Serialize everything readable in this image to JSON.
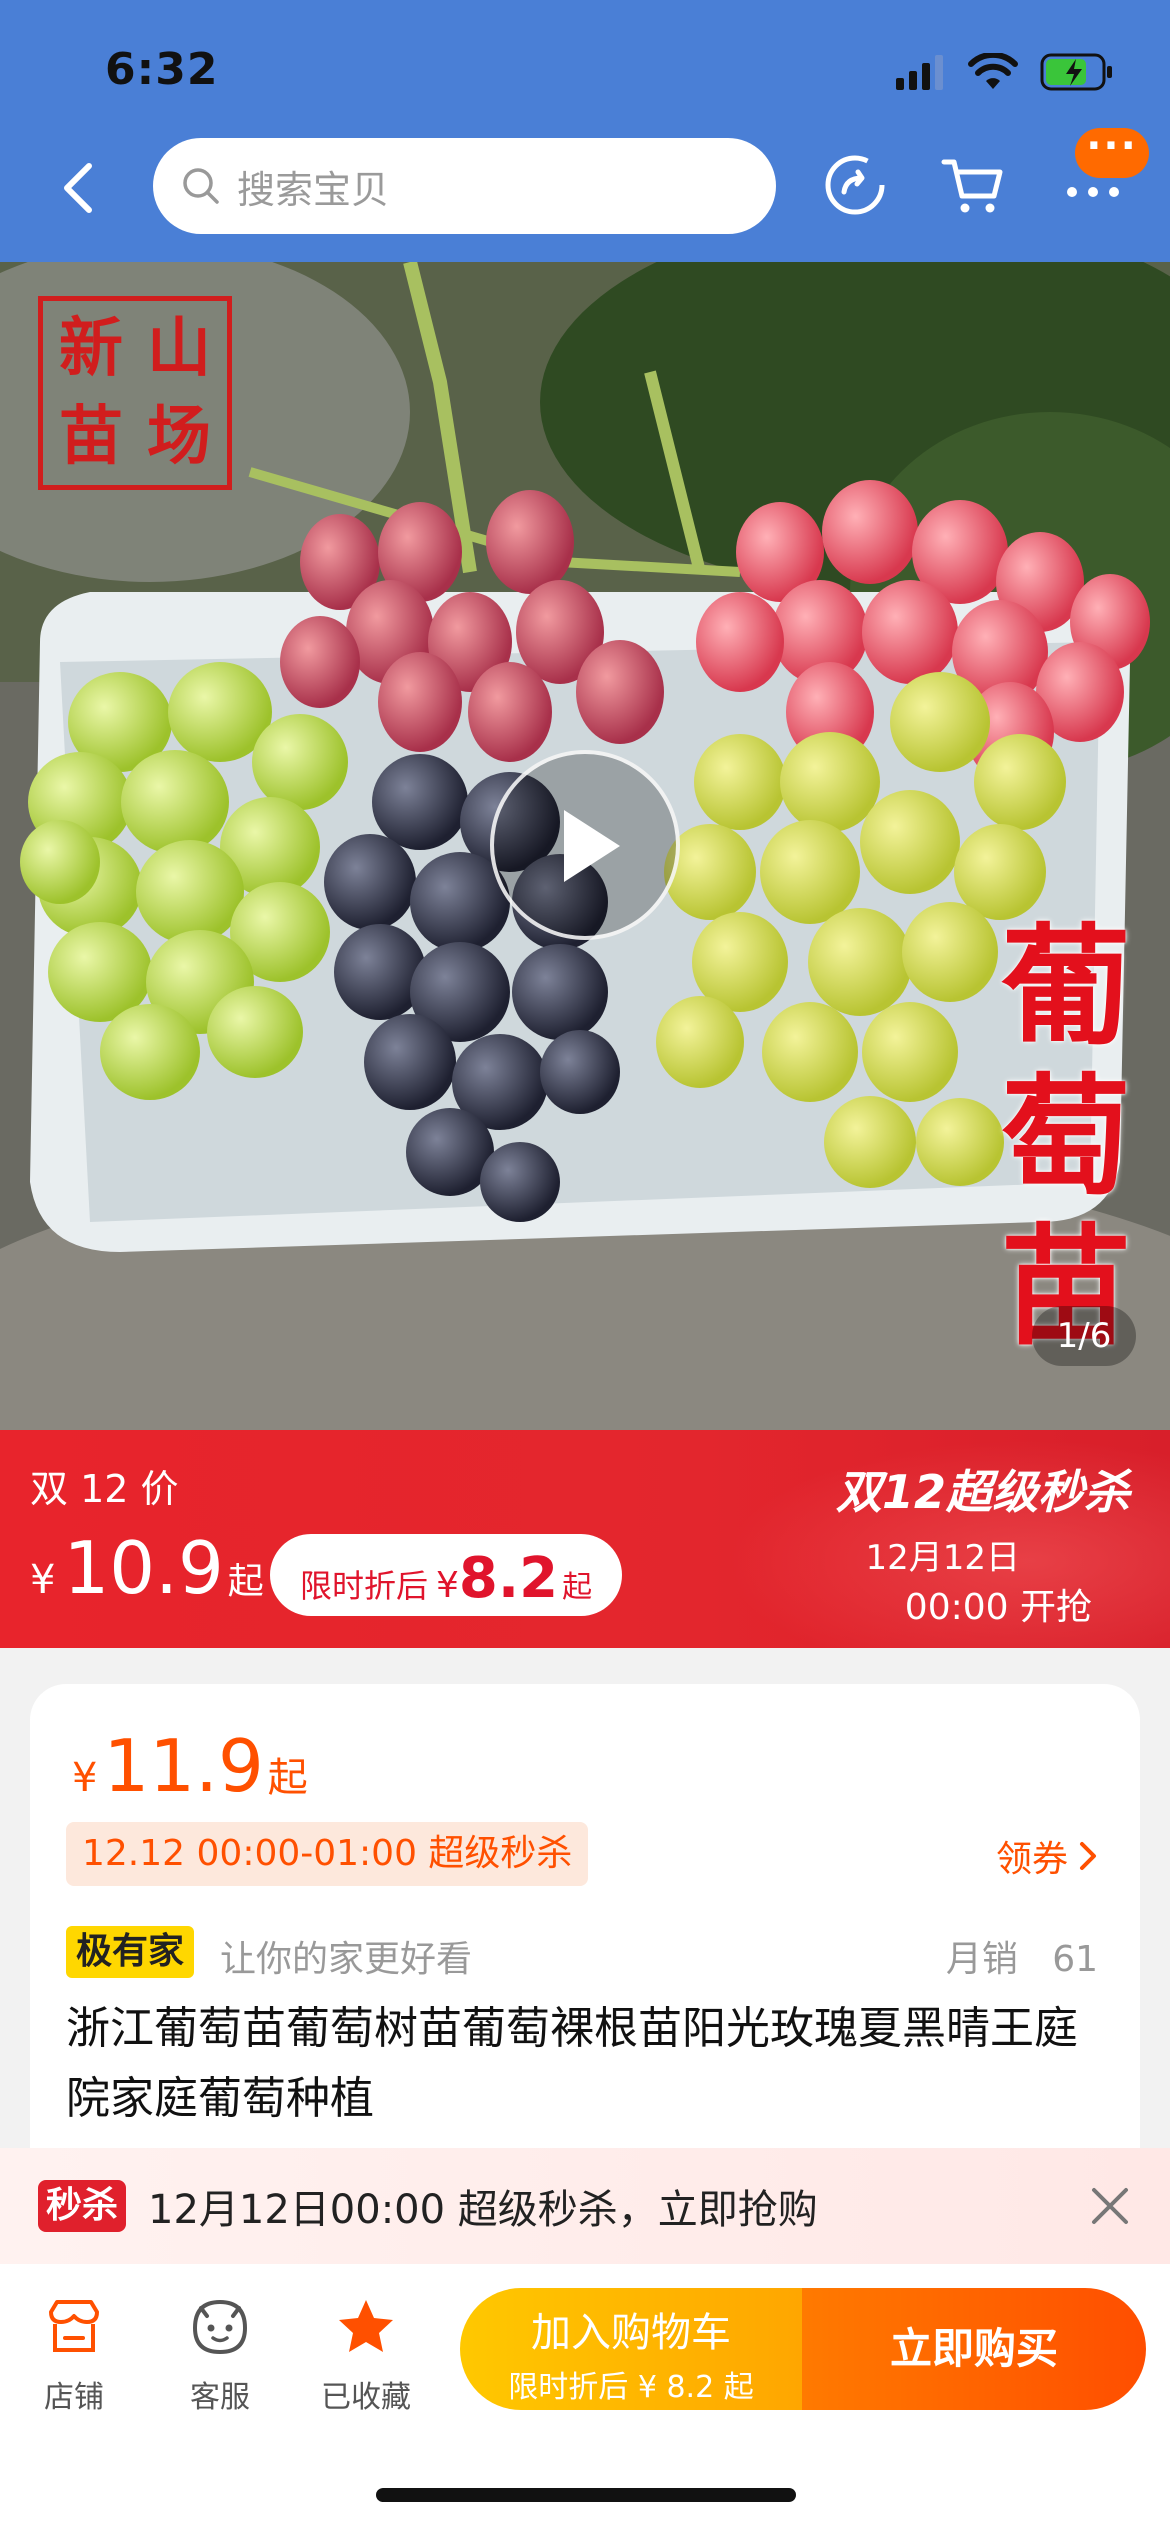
{
  "status_bar": {
    "time": "6:32"
  },
  "header": {
    "search_placeholder": "搜索宝贝",
    "message_badge": "···",
    "colors": {
      "header_bg": "#4a7fd6",
      "badge": "#ff6a00"
    }
  },
  "hero": {
    "seal_text": [
      "新",
      "山",
      "苗",
      "场"
    ],
    "vertical_text": [
      "葡",
      "萄",
      "苗"
    ],
    "counter": "1/6"
  },
  "promo_banner": {
    "label": "双 12 价",
    "currency": "¥",
    "price": "10.9",
    "price_suffix": "起",
    "discount_label": "限时折后",
    "discount_currency": "¥",
    "discount_price": "8.2",
    "discount_suffix": "起",
    "event_title": "双12超级秒杀",
    "event_date": "12月12日",
    "event_time": "00:00 开抢",
    "colors": {
      "bg": "#e3262d"
    }
  },
  "product": {
    "currency": "¥",
    "price": "11.9",
    "price_suffix": "起",
    "flash_tag": "12.12 00:00-01:00 超级秒杀",
    "coupon_label": "领券",
    "brand_tag": "极有家",
    "slogan": "让你的家更好看",
    "sales_label": "月销",
    "sales_count": "61",
    "title": "浙江葡萄苗葡萄树苗葡萄裸根苗阳光玫瑰夏黑晴王庭院家庭葡萄种植",
    "colors": {
      "price": "#ff5000"
    }
  },
  "flash_sale_bar": {
    "badge": "秒杀",
    "text": "12月12日00:00 超级秒杀，立即抢购"
  },
  "bottom_bar": {
    "tabs": [
      {
        "label": "店铺",
        "icon": "store-icon"
      },
      {
        "label": "客服",
        "icon": "customer-service-icon"
      },
      {
        "label": "已收藏",
        "icon": "star-icon"
      }
    ],
    "add_to_cart": "加入购物车",
    "add_to_cart_sub": "限时折后 ¥ 8.2 起",
    "buy_now": "立即购买",
    "colors": {
      "cart": "#ffb800",
      "buy": "#ff5a00",
      "star": "#ff5000"
    }
  }
}
